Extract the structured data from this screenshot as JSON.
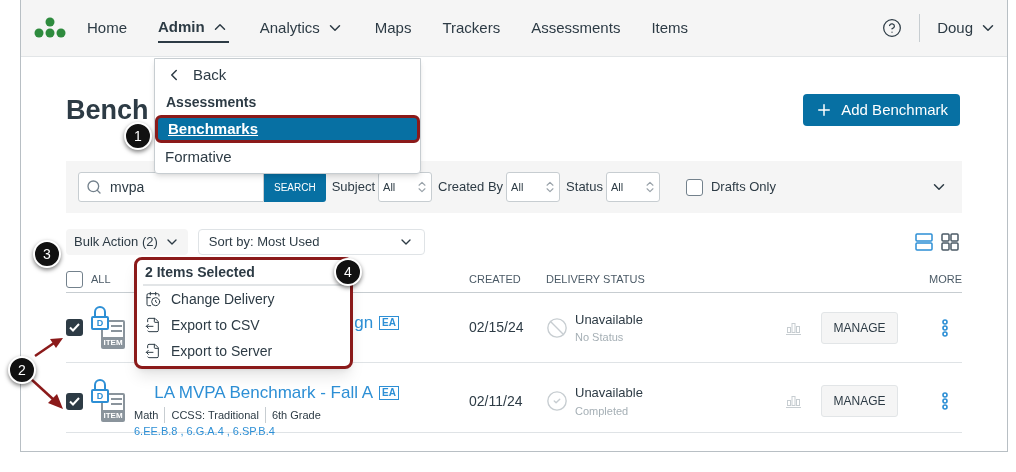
{
  "nav": {
    "items": [
      {
        "label": "Home",
        "has_menu": false,
        "selected": false
      },
      {
        "label": "Admin",
        "has_menu": true,
        "expanded": true,
        "selected": true
      },
      {
        "label": "Analytics",
        "has_menu": true,
        "expanded": false,
        "selected": false
      },
      {
        "label": "Maps",
        "has_menu": false,
        "selected": false
      },
      {
        "label": "Trackers",
        "has_menu": false,
        "selected": false
      },
      {
        "label": "Assessments",
        "has_menu": false,
        "selected": false
      },
      {
        "label": "Items",
        "has_menu": false,
        "selected": false
      }
    ],
    "user": "Doug"
  },
  "admin_menu": {
    "back": "Back",
    "heading": "Assessments",
    "items": [
      {
        "label": "Benchmarks",
        "selected": true
      },
      {
        "label": "Formative",
        "selected": false
      }
    ]
  },
  "page_title": "Bench",
  "add_button": "Add Benchmark",
  "filters": {
    "search": {
      "value": "mvpa"
    },
    "search_button": "SEARCH",
    "selects": [
      {
        "label": "Subject",
        "value": "All"
      },
      {
        "label": "Created By",
        "value": "All"
      },
      {
        "label": "Status",
        "value": "All"
      }
    ],
    "drafts_only": {
      "label": "Drafts Only",
      "checked": false
    }
  },
  "toolbar": {
    "bulk_action": "Bulk Action (2)",
    "sort": {
      "label": "Sort by:",
      "value": "Most Used"
    },
    "views": [
      {
        "kind": "list",
        "selected": true
      },
      {
        "kind": "grid",
        "selected": false
      }
    ]
  },
  "bulk_menu": {
    "heading": "2 Items Selected",
    "items": [
      {
        "kind": "calendar",
        "label": "Change Delivery"
      },
      {
        "kind": "export",
        "label": "Export to CSV"
      },
      {
        "kind": "export",
        "label": "Export to Server"
      }
    ]
  },
  "table": {
    "select_all": {
      "label": "ALL",
      "checked": false
    },
    "columns": [
      "CREATED",
      "DELIVERY STATUS",
      "MORE"
    ],
    "rows": [
      {
        "checked": true,
        "icon_letter": "D",
        "icon_label": "ITEM",
        "title": "gn",
        "badge": "EA",
        "meta": [],
        "tags": [],
        "created": "02/15/24",
        "status": {
          "kind": "none",
          "label": "Unavailable",
          "detail": "No Status"
        },
        "action": "MANAGE"
      },
      {
        "checked": true,
        "icon_letter": "D",
        "icon_label": "ITEM",
        "title": "LA MVPA Benchmark - Fall A",
        "badge": "EA",
        "meta": [
          "Math",
          "CCSS: Traditional",
          "6th Grade"
        ],
        "tags": [
          "6.EE.B.8",
          "6.G.A.4",
          "6.SP.B.4"
        ],
        "tag_separator": ",",
        "created": "02/11/24",
        "status": {
          "kind": "completed",
          "label": "Unavailable",
          "detail": "Completed"
        },
        "action": "MANAGE"
      }
    ]
  },
  "callouts": [
    "1",
    "2",
    "3",
    "4"
  ]
}
